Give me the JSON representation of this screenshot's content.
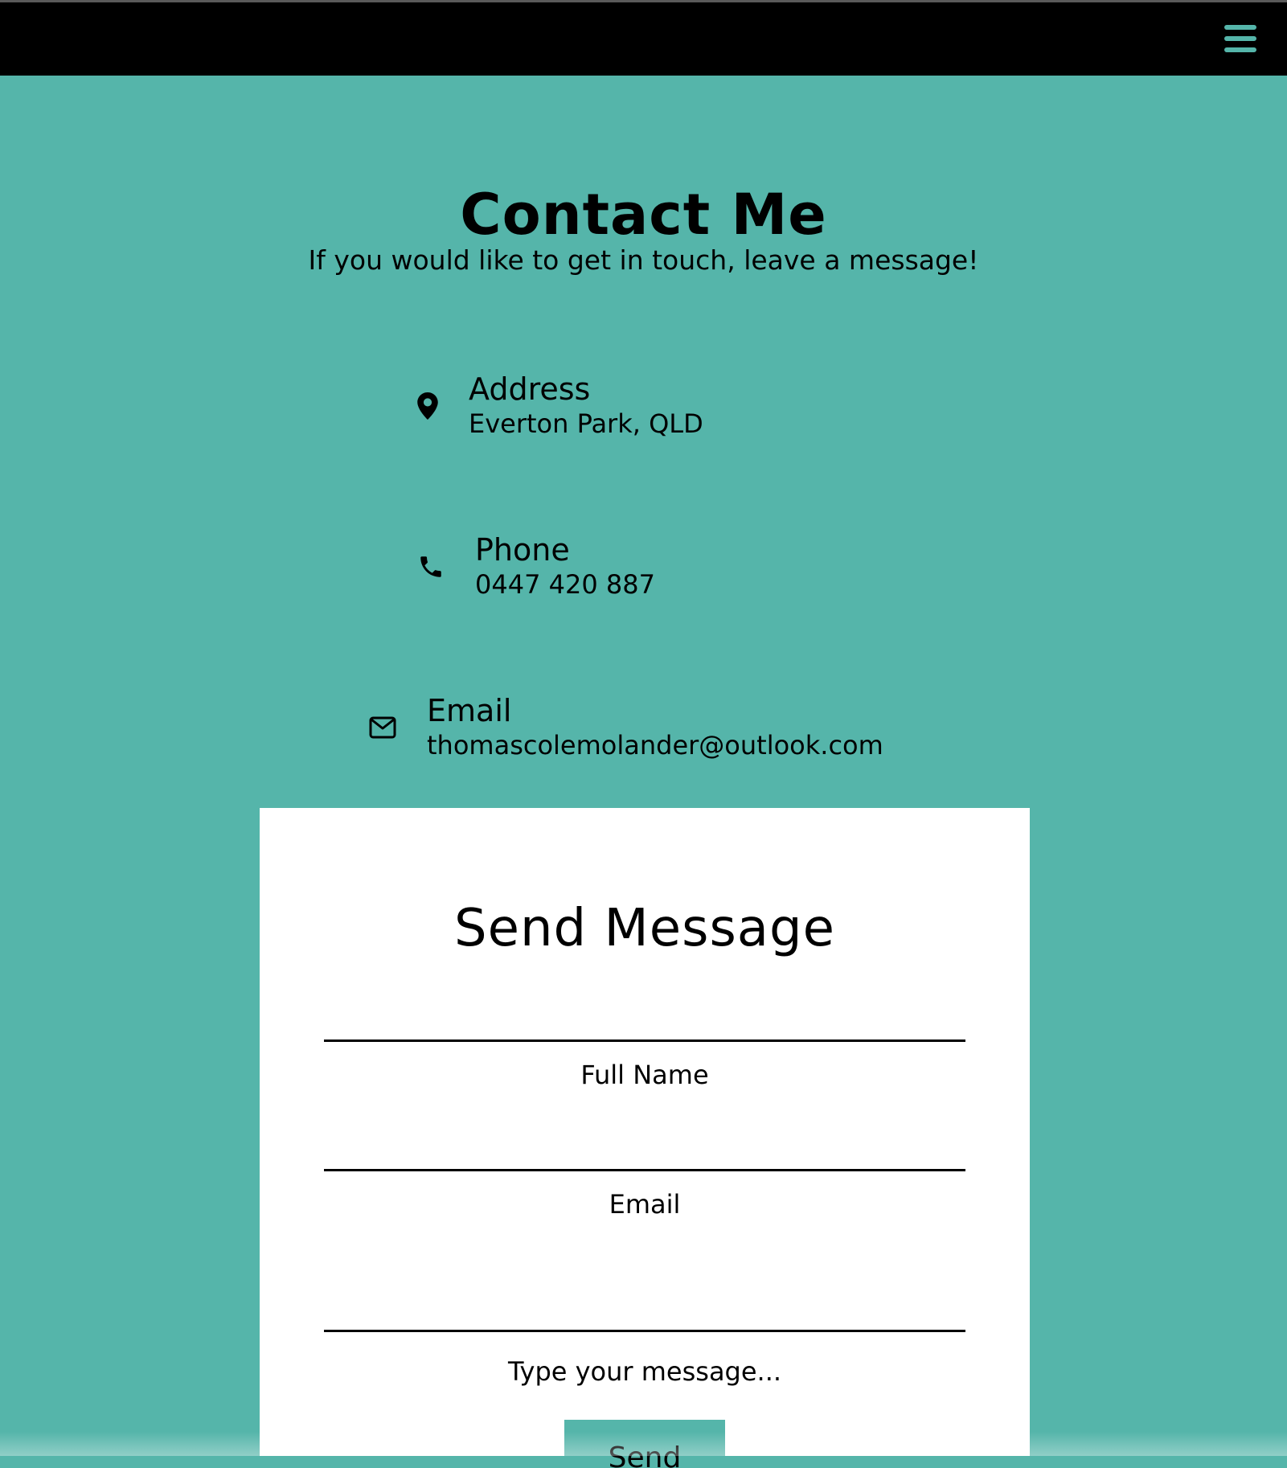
{
  "nav": {
    "menu_icon": "hamburger-menu-icon"
  },
  "header": {
    "title": "Contact Me",
    "subtitle": "If you would like to get in touch, leave a message!"
  },
  "contact_info": {
    "address": {
      "icon": "map-pin-icon",
      "label": "Address",
      "value": "Everton Park, QLD"
    },
    "phone": {
      "icon": "phone-icon",
      "label": "Phone",
      "value": "0447 420 887"
    },
    "email": {
      "icon": "envelope-icon",
      "label": "Email",
      "value": "thomascolemolander@outlook.com"
    }
  },
  "form": {
    "title": "Send Message",
    "fields": {
      "full_name": {
        "label": "Full Name",
        "value": ""
      },
      "email": {
        "label": "Email",
        "value": ""
      },
      "message": {
        "label": "Type your message...",
        "value": ""
      }
    },
    "submit_label": "Send"
  },
  "colors": {
    "accent": "#55b5aa",
    "navbar": "#000000",
    "card": "#ffffff",
    "text": "#000000"
  }
}
